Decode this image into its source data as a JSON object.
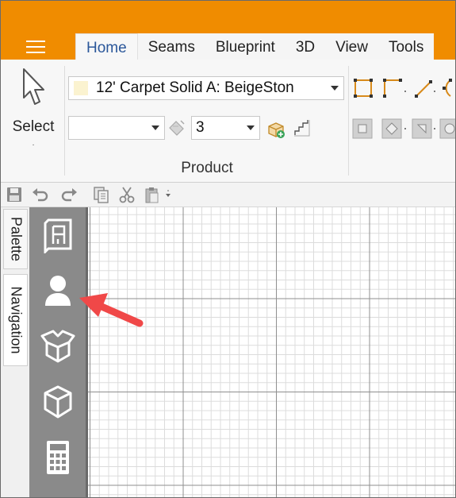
{
  "menu": {
    "icon": "hamburger-menu-icon"
  },
  "tabs": [
    {
      "label": "Home",
      "active": true
    },
    {
      "label": "Seams",
      "active": false
    },
    {
      "label": "Blueprint",
      "active": false
    },
    {
      "label": "3D",
      "active": false
    },
    {
      "label": "View",
      "active": false
    },
    {
      "label": "Tools",
      "active": false
    }
  ],
  "ribbon": {
    "select_label": "Select",
    "select_caret": "·",
    "product": {
      "selected": "12' Carpet Solid A: BeigeSton",
      "swatch_color": "#fbf3d0",
      "group_label": "Product"
    },
    "empty_combo_value": "",
    "number_combo_value": "3"
  },
  "qat": {
    "items": [
      "save-icon",
      "undo-icon",
      "redo-icon",
      "copy-icon",
      "cut-icon",
      "paste-icon"
    ]
  },
  "side_tabs": [
    {
      "label": "Palette"
    },
    {
      "label": "Navigation"
    }
  ],
  "side_strip": {
    "items": [
      "blueprint-icon",
      "user-icon",
      "open-box-icon",
      "cube-icon",
      "calculator-icon"
    ]
  },
  "colors": {
    "title_bar": "#f08c00",
    "ribbon_bg": "#f7f7f7",
    "strip_bg": "#8a8a8a",
    "shape_tool": "#d88a1a",
    "annotation_arrow": "#f04848"
  }
}
